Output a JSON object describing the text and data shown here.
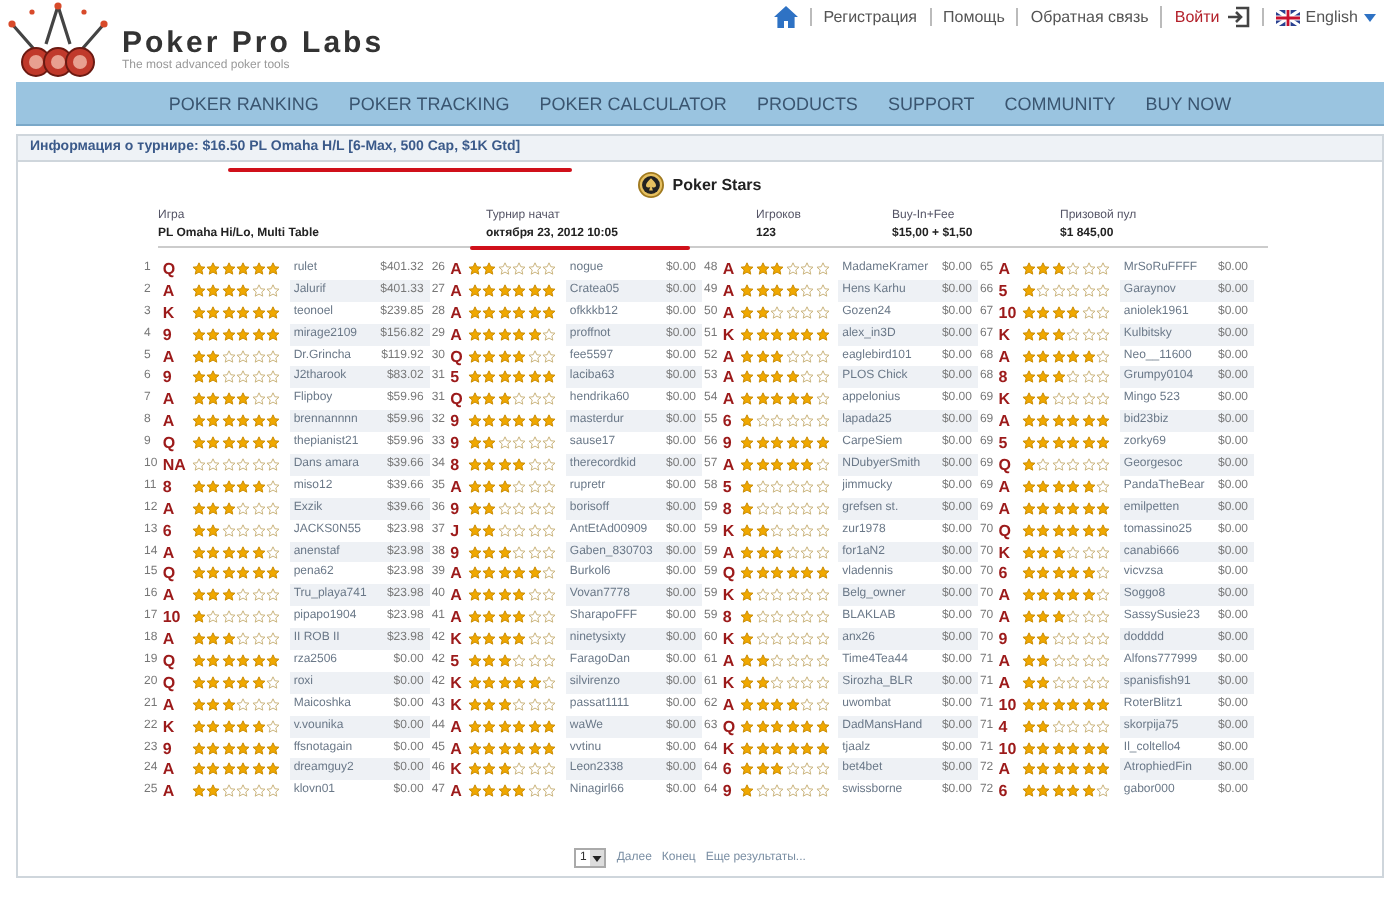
{
  "header": {
    "title": "Poker Pro Labs",
    "tagline": "The most advanced poker tools",
    "links": [
      {
        "kind": "home"
      },
      {
        "kind": "link",
        "label": "Регистрация"
      },
      {
        "kind": "link",
        "label": "Помощь"
      },
      {
        "kind": "link",
        "label": "Обратная связь"
      },
      {
        "kind": "login",
        "label": "Войти"
      },
      {
        "kind": "language",
        "label": "English"
      }
    ]
  },
  "nav": [
    "POKER RANKING",
    "POKER TRACKING",
    "POKER CALCULATOR",
    "PRODUCTS",
    "SUPPORT",
    "COMMUNITY",
    "BUY NOW"
  ],
  "info_bar": {
    "label": "Информация о турнире:",
    "value": "$16.50 PL Omaha H/L [6-Max, 500 Cap, $1K Gtd]"
  },
  "site": "Poker Stars",
  "details": [
    {
      "label": "Игра",
      "value": "PL Omaha Hi/Lo, Multi Table"
    },
    {
      "label": "Турнир начат",
      "value": "октября 23, 2012 10:05"
    },
    {
      "label": "Игроков",
      "value": "123"
    },
    {
      "label": "Buy-In+Fee",
      "value": "$15,00 + $1,50"
    },
    {
      "label": "Призовой пул",
      "value": "$1 845,00"
    }
  ],
  "results": [
    [
      {
        "rank": "1",
        "card": "Q",
        "stars": 6,
        "name": "rulet",
        "prize": "$401.32"
      },
      {
        "rank": "2",
        "card": "A",
        "stars": 4,
        "name": "Jalurif",
        "prize": "$401.33"
      },
      {
        "rank": "3",
        "card": "K",
        "stars": 6,
        "name": "teonoel",
        "prize": "$239.85"
      },
      {
        "rank": "4",
        "card": "9",
        "stars": 6,
        "name": "mirage2109",
        "prize": "$156.82"
      },
      {
        "rank": "5",
        "card": "A",
        "stars": 2,
        "name": "Dr.Grincha",
        "prize": "$119.92"
      },
      {
        "rank": "6",
        "card": "9",
        "stars": 2,
        "name": "J2tharook",
        "prize": "$83.02"
      },
      {
        "rank": "7",
        "card": "A",
        "stars": 4,
        "name": "Flipboy",
        "prize": "$59.96"
      },
      {
        "rank": "8",
        "card": "A",
        "stars": 6,
        "name": "brennannnn",
        "prize": "$59.96"
      },
      {
        "rank": "9",
        "card": "Q",
        "stars": 6,
        "name": "thepianist21",
        "prize": "$59.96"
      },
      {
        "rank": "10",
        "card": "NA",
        "stars": 0,
        "name": "Dans amara",
        "prize": "$39.66"
      },
      {
        "rank": "11",
        "card": "8",
        "stars": 5,
        "name": "miso12",
        "prize": "$39.66"
      },
      {
        "rank": "12",
        "card": "A",
        "stars": 3,
        "name": "Exzik",
        "prize": "$39.66"
      },
      {
        "rank": "13",
        "card": "6",
        "stars": 2,
        "name": "JACKS0N55",
        "prize": "$23.98"
      },
      {
        "rank": "14",
        "card": "A",
        "stars": 5,
        "name": "anenstaf",
        "prize": "$23.98"
      },
      {
        "rank": "15",
        "card": "Q",
        "stars": 6,
        "name": "pena62",
        "prize": "$23.98"
      },
      {
        "rank": "16",
        "card": "A",
        "stars": 3,
        "name": "Tru_playa741",
        "prize": "$23.98"
      },
      {
        "rank": "17",
        "card": "10",
        "stars": 1,
        "name": "pipapo1904",
        "prize": "$23.98"
      },
      {
        "rank": "18",
        "card": "A",
        "stars": 3,
        "name": "II ROB II",
        "prize": "$23.98"
      },
      {
        "rank": "19",
        "card": "Q",
        "stars": 6,
        "name": "rza2506",
        "prize": "$0.00"
      },
      {
        "rank": "20",
        "card": "Q",
        "stars": 5,
        "name": "roxi",
        "prize": "$0.00"
      },
      {
        "rank": "21",
        "card": "A",
        "stars": 3,
        "name": "Maicoshka",
        "prize": "$0.00"
      },
      {
        "rank": "22",
        "card": "K",
        "stars": 5,
        "name": "v.vounika",
        "prize": "$0.00"
      },
      {
        "rank": "23",
        "card": "9",
        "stars": 6,
        "name": "ffsnotagain",
        "prize": "$0.00"
      },
      {
        "rank": "24",
        "card": "A",
        "stars": 6,
        "name": "dreamguy2",
        "prize": "$0.00"
      },
      {
        "rank": "25",
        "card": "A",
        "stars": 2,
        "name": "klovn01",
        "prize": "$0.00"
      }
    ],
    [
      {
        "rank": "26",
        "card": "A",
        "stars": 2,
        "name": "nogue",
        "prize": "$0.00"
      },
      {
        "rank": "27",
        "card": "A",
        "stars": 6,
        "name": "Cratea05",
        "prize": "$0.00"
      },
      {
        "rank": "28",
        "card": "A",
        "stars": 6,
        "name": "ofkkkb12",
        "prize": "$0.00"
      },
      {
        "rank": "29",
        "card": "A",
        "stars": 5,
        "name": "proffnot",
        "prize": "$0.00"
      },
      {
        "rank": "30",
        "card": "Q",
        "stars": 4,
        "name": "fee5597",
        "prize": "$0.00"
      },
      {
        "rank": "31",
        "card": "5",
        "stars": 6,
        "name": "laciba63",
        "prize": "$0.00"
      },
      {
        "rank": "31",
        "card": "Q",
        "stars": 3,
        "name": "hendrika60",
        "prize": "$0.00"
      },
      {
        "rank": "32",
        "card": "9",
        "stars": 6,
        "name": "masterdur",
        "prize": "$0.00"
      },
      {
        "rank": "33",
        "card": "9",
        "stars": 2,
        "name": "sause17",
        "prize": "$0.00"
      },
      {
        "rank": "34",
        "card": "8",
        "stars": 4,
        "name": "therecordkid",
        "prize": "$0.00"
      },
      {
        "rank": "35",
        "card": "A",
        "stars": 3,
        "name": "rupretr",
        "prize": "$0.00"
      },
      {
        "rank": "36",
        "card": "9",
        "stars": 2,
        "name": "borisoff",
        "prize": "$0.00"
      },
      {
        "rank": "37",
        "card": "J",
        "stars": 2,
        "name": "AntEtAd00909",
        "prize": "$0.00"
      },
      {
        "rank": "38",
        "card": "9",
        "stars": 3,
        "name": "Gaben_830703",
        "prize": "$0.00"
      },
      {
        "rank": "39",
        "card": "A",
        "stars": 5,
        "name": "Burkol6",
        "prize": "$0.00"
      },
      {
        "rank": "40",
        "card": "A",
        "stars": 4,
        "name": "Vovan7778",
        "prize": "$0.00"
      },
      {
        "rank": "41",
        "card": "A",
        "stars": 4,
        "name": "SharapoFFF",
        "prize": "$0.00"
      },
      {
        "rank": "42",
        "card": "K",
        "stars": 4,
        "name": "ninetysixty",
        "prize": "$0.00"
      },
      {
        "rank": "42",
        "card": "5",
        "stars": 3,
        "name": "FaragoDan",
        "prize": "$0.00"
      },
      {
        "rank": "42",
        "card": "K",
        "stars": 5,
        "name": "silvirenzo",
        "prize": "$0.00"
      },
      {
        "rank": "43",
        "card": "K",
        "stars": 3,
        "name": "passat1111",
        "prize": "$0.00"
      },
      {
        "rank": "44",
        "card": "A",
        "stars": 6,
        "name": "waWe",
        "prize": "$0.00"
      },
      {
        "rank": "45",
        "card": "A",
        "stars": 6,
        "name": "vvtinu",
        "prize": "$0.00"
      },
      {
        "rank": "46",
        "card": "K",
        "stars": 3,
        "name": "Leon2338",
        "prize": "$0.00"
      },
      {
        "rank": "47",
        "card": "A",
        "stars": 4,
        "name": "Ninagirl66",
        "prize": "$0.00"
      }
    ],
    [
      {
        "rank": "48",
        "card": "A",
        "stars": 3,
        "name": "MadameKramer",
        "prize": "$0.00"
      },
      {
        "rank": "49",
        "card": "A",
        "stars": 4,
        "name": "Hens Karhu",
        "prize": "$0.00"
      },
      {
        "rank": "50",
        "card": "A",
        "stars": 2,
        "name": "Gozen24",
        "prize": "$0.00"
      },
      {
        "rank": "51",
        "card": "K",
        "stars": 6,
        "name": "alex_in3D",
        "prize": "$0.00"
      },
      {
        "rank": "52",
        "card": "A",
        "stars": 3,
        "name": "eaglebird101",
        "prize": "$0.00"
      },
      {
        "rank": "53",
        "card": "A",
        "stars": 4,
        "name": "PLOS Chick",
        "prize": "$0.00"
      },
      {
        "rank": "54",
        "card": "A",
        "stars": 5,
        "name": "appelonius",
        "prize": "$0.00"
      },
      {
        "rank": "55",
        "card": "6",
        "stars": 1,
        "name": "lapada25",
        "prize": "$0.00"
      },
      {
        "rank": "56",
        "card": "9",
        "stars": 6,
        "name": "CarpeSiem",
        "prize": "$0.00"
      },
      {
        "rank": "57",
        "card": "A",
        "stars": 5,
        "name": "NDubyerSmith",
        "prize": "$0.00"
      },
      {
        "rank": "58",
        "card": "5",
        "stars": 1,
        "name": "jimmucky",
        "prize": "$0.00"
      },
      {
        "rank": "59",
        "card": "8",
        "stars": 1,
        "name": "grefsen st.",
        "prize": "$0.00"
      },
      {
        "rank": "59",
        "card": "K",
        "stars": 2,
        "name": "zur1978",
        "prize": "$0.00"
      },
      {
        "rank": "59",
        "card": "A",
        "stars": 3,
        "name": "for1aN2",
        "prize": "$0.00"
      },
      {
        "rank": "59",
        "card": "Q",
        "stars": 6,
        "name": "vladennis",
        "prize": "$0.00"
      },
      {
        "rank": "59",
        "card": "K",
        "stars": 1,
        "name": "Belg_owner",
        "prize": "$0.00"
      },
      {
        "rank": "59",
        "card": "8",
        "stars": 1,
        "name": "BLAKLAB",
        "prize": "$0.00"
      },
      {
        "rank": "60",
        "card": "K",
        "stars": 1,
        "name": "anx26",
        "prize": "$0.00"
      },
      {
        "rank": "61",
        "card": "A",
        "stars": 2,
        "name": "Time4Tea44",
        "prize": "$0.00"
      },
      {
        "rank": "61",
        "card": "K",
        "stars": 2,
        "name": "Sirozha_BLR",
        "prize": "$0.00"
      },
      {
        "rank": "62",
        "card": "A",
        "stars": 4,
        "name": "uwombat",
        "prize": "$0.00"
      },
      {
        "rank": "63",
        "card": "Q",
        "stars": 6,
        "name": "DadMansHand",
        "prize": "$0.00"
      },
      {
        "rank": "64",
        "card": "K",
        "stars": 6,
        "name": "tjaalz",
        "prize": "$0.00"
      },
      {
        "rank": "64",
        "card": "6",
        "stars": 3,
        "name": "bet4bet",
        "prize": "$0.00"
      },
      {
        "rank": "64",
        "card": "9",
        "stars": 1,
        "name": "swissborne",
        "prize": "$0.00"
      }
    ],
    [
      {
        "rank": "65",
        "card": "A",
        "stars": 3,
        "name": "MrSoRuFFFF",
        "prize": "$0.00"
      },
      {
        "rank": "66",
        "card": "5",
        "stars": 1,
        "name": "Garaynov",
        "prize": "$0.00"
      },
      {
        "rank": "67",
        "card": "10",
        "stars": 4,
        "name": "aniolek1961",
        "prize": "$0.00"
      },
      {
        "rank": "67",
        "card": "K",
        "stars": 3,
        "name": "Kulbitsky",
        "prize": "$0.00"
      },
      {
        "rank": "68",
        "card": "A",
        "stars": 5,
        "name": "Neo__11600",
        "prize": "$0.00"
      },
      {
        "rank": "68",
        "card": "8",
        "stars": 3,
        "name": "Grumpy0104",
        "prize": "$0.00"
      },
      {
        "rank": "69",
        "card": "K",
        "stars": 2,
        "name": "Mingo 523",
        "prize": "$0.00"
      },
      {
        "rank": "69",
        "card": "A",
        "stars": 6,
        "name": "bid23biz",
        "prize": "$0.00"
      },
      {
        "rank": "69",
        "card": "5",
        "stars": 6,
        "name": "zorky69",
        "prize": "$0.00"
      },
      {
        "rank": "69",
        "card": "Q",
        "stars": 1,
        "name": "Georgesoc",
        "prize": "$0.00"
      },
      {
        "rank": "69",
        "card": "A",
        "stars": 5,
        "name": "PandaTheBear",
        "prize": "$0.00"
      },
      {
        "rank": "69",
        "card": "A",
        "stars": 6,
        "name": "emilpetten",
        "prize": "$0.00"
      },
      {
        "rank": "70",
        "card": "Q",
        "stars": 6,
        "name": "tomassino25",
        "prize": "$0.00"
      },
      {
        "rank": "70",
        "card": "K",
        "stars": 3,
        "name": "canabi666",
        "prize": "$0.00"
      },
      {
        "rank": "70",
        "card": "6",
        "stars": 5,
        "name": "vicvzsa",
        "prize": "$0.00"
      },
      {
        "rank": "70",
        "card": "A",
        "stars": 5,
        "name": "Soggo8",
        "prize": "$0.00"
      },
      {
        "rank": "70",
        "card": "A",
        "stars": 3,
        "name": "SassySusie23",
        "prize": "$0.00"
      },
      {
        "rank": "70",
        "card": "9",
        "stars": 2,
        "name": "dodddd",
        "prize": "$0.00"
      },
      {
        "rank": "71",
        "card": "A",
        "stars": 2,
        "name": "Alfons777999",
        "prize": "$0.00"
      },
      {
        "rank": "71",
        "card": "A",
        "stars": 2,
        "name": "spanisfish91",
        "prize": "$0.00"
      },
      {
        "rank": "71",
        "card": "10",
        "stars": 6,
        "name": "RoterBlitz1",
        "prize": "$0.00"
      },
      {
        "rank": "71",
        "card": "4",
        "stars": 2,
        "name": "skorpija75",
        "prize": "$0.00"
      },
      {
        "rank": "71",
        "card": "10",
        "stars": 6,
        "name": "Il_coltello4",
        "prize": "$0.00"
      },
      {
        "rank": "72",
        "card": "A",
        "stars": 6,
        "name": "AtrophiedFin",
        "prize": "$0.00"
      },
      {
        "rank": "72",
        "card": "6",
        "stars": 5,
        "name": "gabor000",
        "prize": "$0.00"
      }
    ]
  ],
  "pager": {
    "page": "1",
    "links": [
      "Далее",
      "Конец",
      "Еще результаты..."
    ]
  }
}
